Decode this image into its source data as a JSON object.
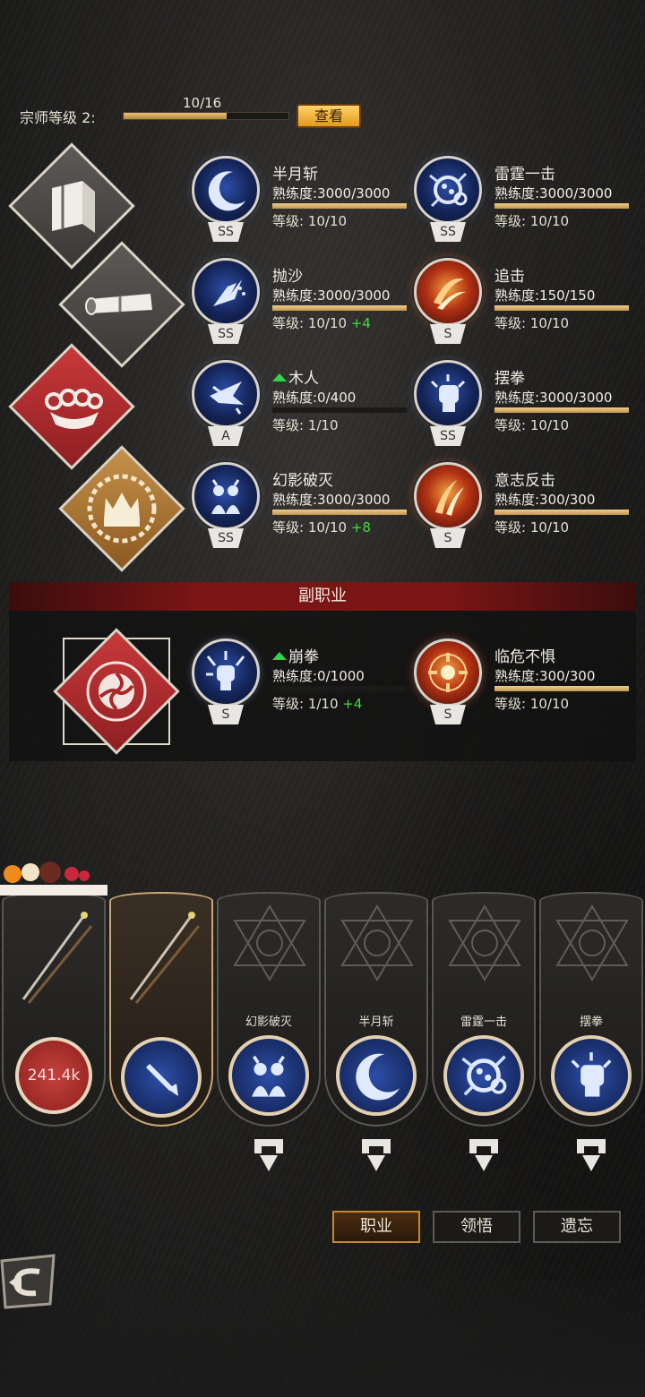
{
  "grandmaster": {
    "label": "宗师等级 2:",
    "progress_text": "10/16",
    "progress": 0.625,
    "view_button": "查看"
  },
  "skills": [
    {
      "name": "半月斩",
      "prof": "熟练度:3000/3000",
      "prof_pct": 1.0,
      "level": "等级: 10/10",
      "bonus": "",
      "rank": "SS",
      "icon": "crescent-moon-icon",
      "upgrade": false
    },
    {
      "name": "雷霆一击",
      "prof": "熟练度:3000/3000",
      "prof_pct": 1.0,
      "level": "等级: 10/10",
      "bonus": "",
      "rank": "SS",
      "icon": "thunder-orb-icon",
      "upgrade": false
    },
    {
      "name": "抛沙",
      "prof": "熟练度:3000/3000",
      "prof_pct": 1.0,
      "level": "等级: 10/10",
      "bonus": "+4",
      "rank": "SS",
      "icon": "sand-throw-icon",
      "upgrade": false
    },
    {
      "name": "追击",
      "prof": "熟练度:150/150",
      "prof_pct": 1.0,
      "level": "等级: 10/10",
      "bonus": "",
      "rank": "S",
      "icon": "fire-slash-icon",
      "upgrade": false
    },
    {
      "name": "木人",
      "prof": "熟练度:0/400",
      "prof_pct": 0.0,
      "level": "等级: 1/10",
      "bonus": "",
      "rank": "A",
      "icon": "wooden-dummy-icon",
      "upgrade": true
    },
    {
      "name": "摆拳",
      "prof": "熟练度:3000/3000",
      "prof_pct": 1.0,
      "level": "等级: 10/10",
      "bonus": "",
      "rank": "SS",
      "icon": "fist-icon",
      "upgrade": false
    },
    {
      "name": "幻影破灭",
      "prof": "熟练度:3000/3000",
      "prof_pct": 1.0,
      "level": "等级: 10/10",
      "bonus": "+8",
      "rank": "SS",
      "icon": "phantom-twins-icon",
      "upgrade": false
    },
    {
      "name": "意志反击",
      "prof": "熟练度:300/300",
      "prof_pct": 1.0,
      "level": "等级: 10/10",
      "bonus": "",
      "rank": "S",
      "icon": "fire-claw-icon",
      "upgrade": false
    }
  ],
  "sub_career": {
    "title": "副职业",
    "skills": [
      {
        "name": "崩拳",
        "prof": "熟练度:0/1000",
        "prof_pct": 0.0,
        "level": "等级: 1/10",
        "bonus": "+4",
        "rank": "S",
        "icon": "burst-fist-icon",
        "upgrade": true
      },
      {
        "name": "临危不惧",
        "prof": "熟练度:300/300",
        "prof_pct": 1.0,
        "level": "等级: 10/10",
        "bonus": "",
        "rank": "S",
        "icon": "fire-rune-icon",
        "upgrade": false
      }
    ]
  },
  "loadout": {
    "weapon_value": "241.4k",
    "slots": [
      "幻影破灭",
      "半月斩",
      "雷霆一击",
      "摆拳"
    ]
  },
  "tabs": [
    "职业",
    "领悟",
    "遗忘"
  ],
  "active_tab": 0
}
